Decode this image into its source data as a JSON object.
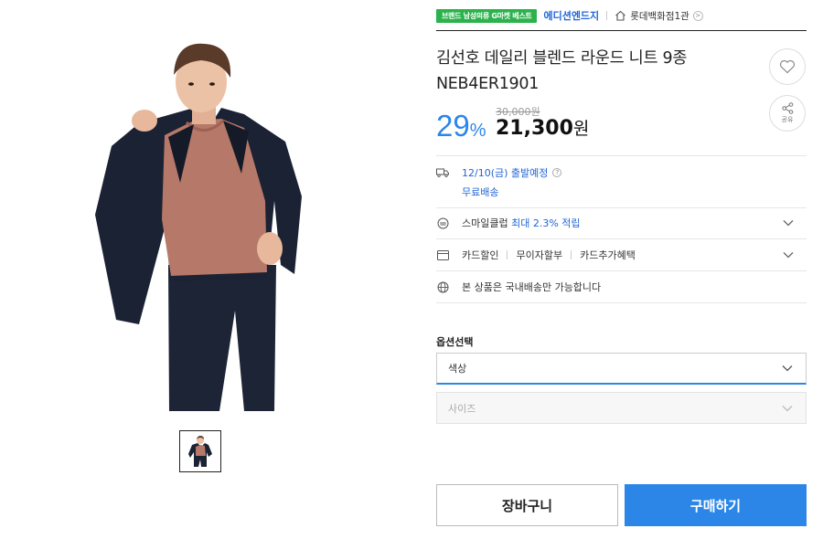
{
  "header": {
    "badge": "브랜드 남성의류 G마켓 베스트",
    "shop_name": "에디션엔드지",
    "department": "롯데백화점1관",
    "department_arrow": ">"
  },
  "product": {
    "title": "김선호 데일리 블렌드 라운드 니트 9종 NEB4ER1901",
    "discount_value": "29",
    "discount_unit": "%",
    "original_price": "30,000원",
    "sale_price": "21,300",
    "sale_currency": "원"
  },
  "share": {
    "label": "공유"
  },
  "delivery": {
    "date_text": "12/10(금) 출발예정",
    "help_icon": "?",
    "free_shipping": "무료배송"
  },
  "smile_club": {
    "label": "스마일클럽",
    "benefit": "최대 2.3% 적립"
  },
  "card": {
    "items": [
      "카드할인",
      "무이자할부",
      "카드추가혜택"
    ]
  },
  "shipping_notice": "본 상품은 국내배송만 가능합니다",
  "options": {
    "section_label": "옵션선택",
    "color_placeholder": "색상",
    "size_placeholder": "사이즈"
  },
  "actions": {
    "cart_label": "장바구니",
    "buy_label": "구매하기"
  },
  "colors": {
    "accent_blue": "#2b86e8",
    "link_blue": "#2166d6",
    "badge_green": "#2bb24c"
  },
  "icons": [
    "home-icon",
    "heart-icon",
    "share-icon",
    "truck-icon",
    "smile-coin-icon",
    "card-icon",
    "globe-icon",
    "chevron-down-icon"
  ]
}
